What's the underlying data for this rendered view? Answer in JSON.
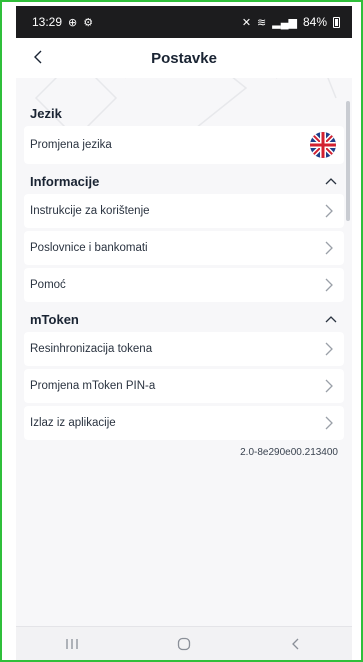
{
  "status_bar": {
    "time": "13:29",
    "battery": "84%"
  },
  "header": {
    "title": "Postavke"
  },
  "sections": {
    "language": {
      "title": "Jezik",
      "item": "Promjena jezika",
      "flag": "uk-flag-icon"
    },
    "info": {
      "title": "Informacije",
      "items": [
        "Instrukcije za korištenje",
        "Poslovnice i bankomati",
        "Pomoć"
      ]
    },
    "mtoken": {
      "title": "mToken",
      "items": [
        "Resinhronizacija tokena",
        "Promjena mToken PIN-a",
        "Izlaz iz aplikacije"
      ]
    }
  },
  "version": "2.0-8e290e00.213400",
  "colors": {
    "accent_frame": "#2fbf3a",
    "title": "#1a2433",
    "background": "#f7f7f9"
  }
}
